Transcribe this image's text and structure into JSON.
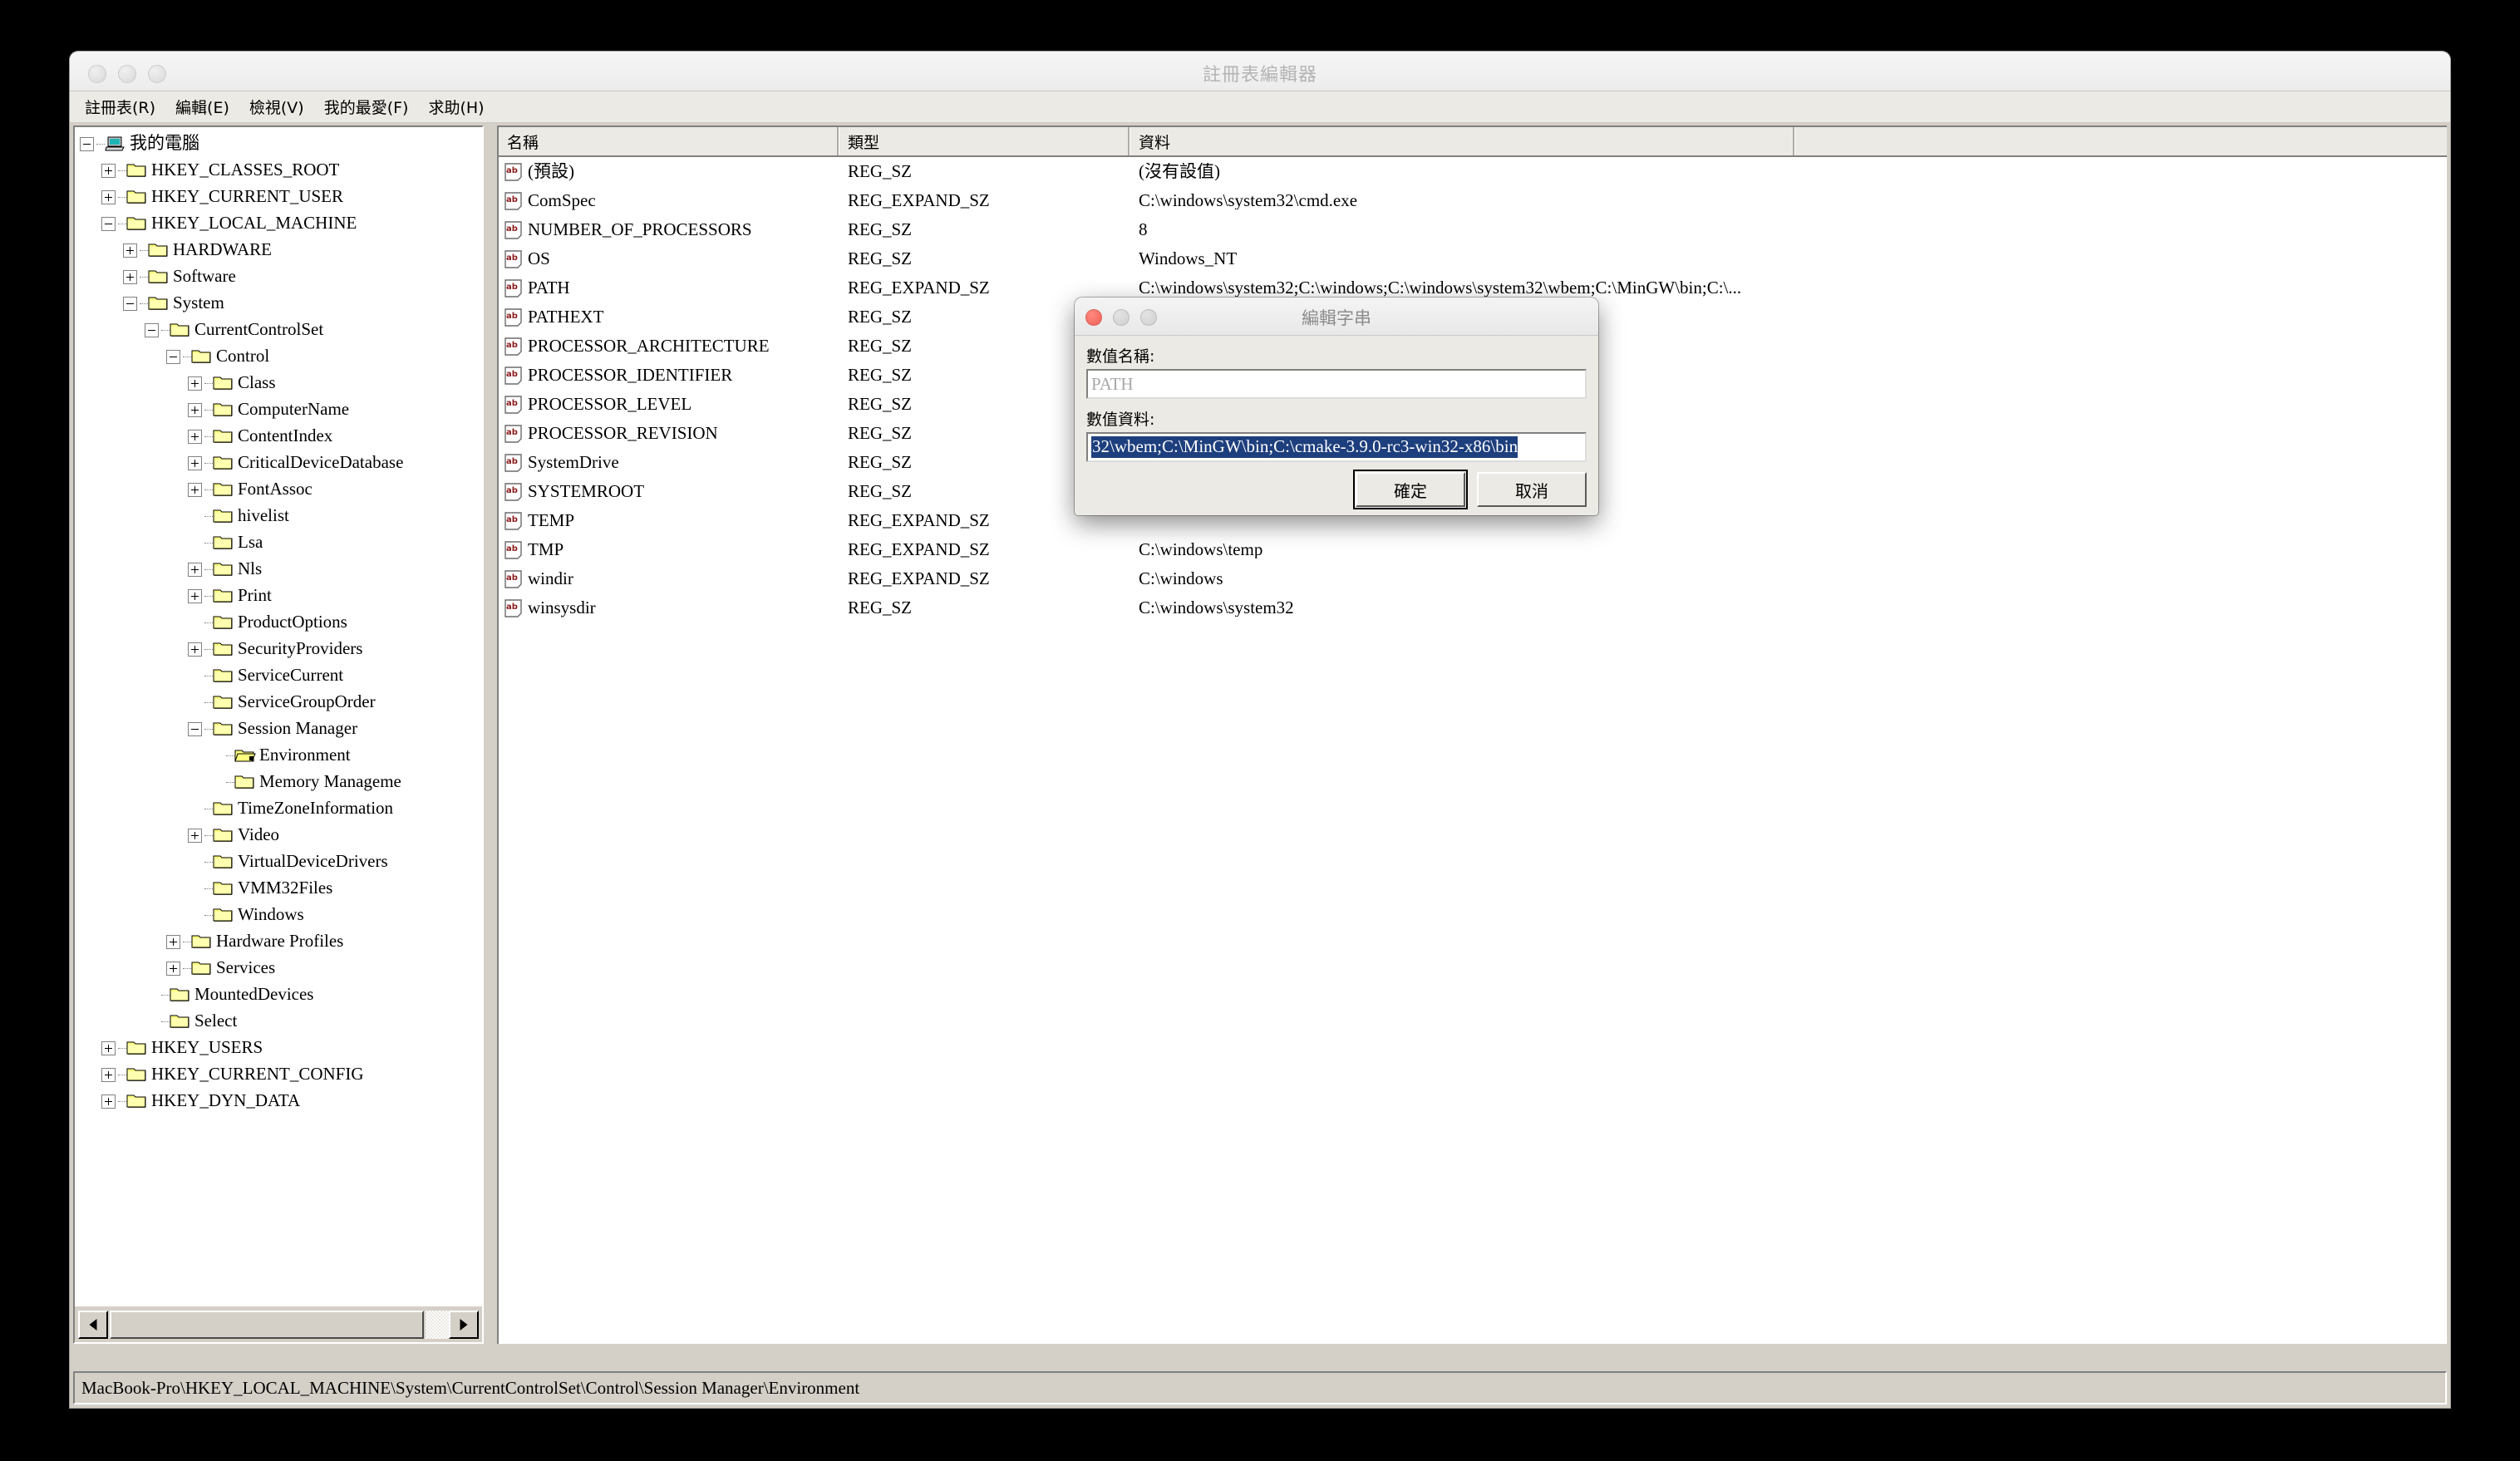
{
  "window": {
    "title": "註冊表編輯器"
  },
  "menubar": {
    "items": [
      {
        "label": "註冊表(R)",
        "name": "menu-registry"
      },
      {
        "label": "編輯(E)",
        "name": "menu-edit"
      },
      {
        "label": "檢視(V)",
        "name": "menu-view"
      },
      {
        "label": "我的最愛(F)",
        "name": "menu-favorites"
      },
      {
        "label": "求助(H)",
        "name": "menu-help"
      }
    ]
  },
  "tree": {
    "nodes": [
      {
        "label": "我的電腦",
        "depth": 0,
        "toggle": "minus",
        "icon": "computer"
      },
      {
        "label": "HKEY_CLASSES_ROOT",
        "depth": 1,
        "toggle": "plus",
        "icon": "folder"
      },
      {
        "label": "HKEY_CURRENT_USER",
        "depth": 1,
        "toggle": "plus",
        "icon": "folder"
      },
      {
        "label": "HKEY_LOCAL_MACHINE",
        "depth": 1,
        "toggle": "minus",
        "icon": "folder"
      },
      {
        "label": "HARDWARE",
        "depth": 2,
        "toggle": "plus",
        "icon": "folder"
      },
      {
        "label": "Software",
        "depth": 2,
        "toggle": "plus",
        "icon": "folder"
      },
      {
        "label": "System",
        "depth": 2,
        "toggle": "minus",
        "icon": "folder"
      },
      {
        "label": "CurrentControlSet",
        "depth": 3,
        "toggle": "minus",
        "icon": "folder"
      },
      {
        "label": "Control",
        "depth": 4,
        "toggle": "minus",
        "icon": "folder"
      },
      {
        "label": "Class",
        "depth": 5,
        "toggle": "plus",
        "icon": "folder"
      },
      {
        "label": "ComputerName",
        "depth": 5,
        "toggle": "plus",
        "icon": "folder"
      },
      {
        "label": "ContentIndex",
        "depth": 5,
        "toggle": "plus",
        "icon": "folder"
      },
      {
        "label": "CriticalDeviceDatabase",
        "depth": 5,
        "toggle": "plus",
        "icon": "folder"
      },
      {
        "label": "FontAssoc",
        "depth": 5,
        "toggle": "plus",
        "icon": "folder"
      },
      {
        "label": "hivelist",
        "depth": 5,
        "toggle": "none",
        "icon": "folder"
      },
      {
        "label": "Lsa",
        "depth": 5,
        "toggle": "none",
        "icon": "folder"
      },
      {
        "label": "Nls",
        "depth": 5,
        "toggle": "plus",
        "icon": "folder"
      },
      {
        "label": "Print",
        "depth": 5,
        "toggle": "plus",
        "icon": "folder"
      },
      {
        "label": "ProductOptions",
        "depth": 5,
        "toggle": "none",
        "icon": "folder"
      },
      {
        "label": "SecurityProviders",
        "depth": 5,
        "toggle": "plus",
        "icon": "folder"
      },
      {
        "label": "ServiceCurrent",
        "depth": 5,
        "toggle": "none",
        "icon": "folder"
      },
      {
        "label": "ServiceGroupOrder",
        "depth": 5,
        "toggle": "none",
        "icon": "folder"
      },
      {
        "label": "Session Manager",
        "depth": 5,
        "toggle": "minus",
        "icon": "folder"
      },
      {
        "label": "Environment",
        "depth": 6,
        "toggle": "none",
        "icon": "folder-open"
      },
      {
        "label": "Memory Manageme",
        "depth": 6,
        "toggle": "none",
        "icon": "folder"
      },
      {
        "label": "TimeZoneInformation",
        "depth": 5,
        "toggle": "none",
        "icon": "folder"
      },
      {
        "label": "Video",
        "depth": 5,
        "toggle": "plus",
        "icon": "folder"
      },
      {
        "label": "VirtualDeviceDrivers",
        "depth": 5,
        "toggle": "none",
        "icon": "folder"
      },
      {
        "label": "VMM32Files",
        "depth": 5,
        "toggle": "none",
        "icon": "folder"
      },
      {
        "label": "Windows",
        "depth": 5,
        "toggle": "none",
        "icon": "folder"
      },
      {
        "label": "Hardware Profiles",
        "depth": 4,
        "toggle": "plus",
        "icon": "folder"
      },
      {
        "label": "Services",
        "depth": 4,
        "toggle": "plus",
        "icon": "folder"
      },
      {
        "label": "MountedDevices",
        "depth": 3,
        "toggle": "none",
        "icon": "folder"
      },
      {
        "label": "Select",
        "depth": 3,
        "toggle": "none",
        "icon": "folder"
      },
      {
        "label": "HKEY_USERS",
        "depth": 1,
        "toggle": "plus",
        "icon": "folder"
      },
      {
        "label": "HKEY_CURRENT_CONFIG",
        "depth": 1,
        "toggle": "plus",
        "icon": "folder"
      },
      {
        "label": "HKEY_DYN_DATA",
        "depth": 1,
        "toggle": "plus",
        "icon": "folder"
      }
    ]
  },
  "list": {
    "columns": [
      "名稱",
      "類型",
      "資料",
      ""
    ],
    "rows": [
      {
        "name": "(預設)",
        "type": "REG_SZ",
        "data": "(沒有設值)"
      },
      {
        "name": "ComSpec",
        "type": "REG_EXPAND_SZ",
        "data": "C:\\windows\\system32\\cmd.exe"
      },
      {
        "name": "NUMBER_OF_PROCESSORS",
        "type": "REG_SZ",
        "data": "8"
      },
      {
        "name": "OS",
        "type": "REG_SZ",
        "data": "Windows_NT"
      },
      {
        "name": "PATH",
        "type": "REG_EXPAND_SZ",
        "data": "C:\\windows\\system32;C:\\windows;C:\\windows\\system32\\wbem;C:\\MinGW\\bin;C:\\..."
      },
      {
        "name": "PATHEXT",
        "type": "REG_SZ",
        "data": ""
      },
      {
        "name": "PROCESSOR_ARCHITECTURE",
        "type": "REG_SZ",
        "data": ""
      },
      {
        "name": "PROCESSOR_IDENTIFIER",
        "type": "REG_SZ",
        "data": ""
      },
      {
        "name": "PROCESSOR_LEVEL",
        "type": "REG_SZ",
        "data": ""
      },
      {
        "name": "PROCESSOR_REVISION",
        "type": "REG_SZ",
        "data": ""
      },
      {
        "name": "SystemDrive",
        "type": "REG_SZ",
        "data": ""
      },
      {
        "name": "SYSTEMROOT",
        "type": "REG_SZ",
        "data": ""
      },
      {
        "name": "TEMP",
        "type": "REG_EXPAND_SZ",
        "data": ""
      },
      {
        "name": "TMP",
        "type": "REG_EXPAND_SZ",
        "data": "C:\\windows\\temp"
      },
      {
        "name": "windir",
        "type": "REG_EXPAND_SZ",
        "data": "C:\\windows"
      },
      {
        "name": "winsysdir",
        "type": "REG_SZ",
        "data": "C:\\windows\\system32"
      }
    ]
  },
  "statusbar": {
    "path": "MacBook-Pro\\HKEY_LOCAL_MACHINE\\System\\CurrentControlSet\\Control\\Session Manager\\Environment"
  },
  "dialog": {
    "title": "編輯字串",
    "name_label": "數值名稱:",
    "name_value": "PATH",
    "data_label": "數值資料:",
    "data_value": "32\\wbem;C:\\MinGW\\bin;C:\\cmake-3.9.0-rc3-win32-x86\\bin",
    "ok_label": "確定",
    "cancel_label": "取消"
  },
  "colors": {
    "desktop": "#000000",
    "window_face": "#d4d0c8",
    "selection_blue": "#1e3f7d",
    "folder_yellow": "#ffff80",
    "ab_red": "#8b1a1a"
  }
}
